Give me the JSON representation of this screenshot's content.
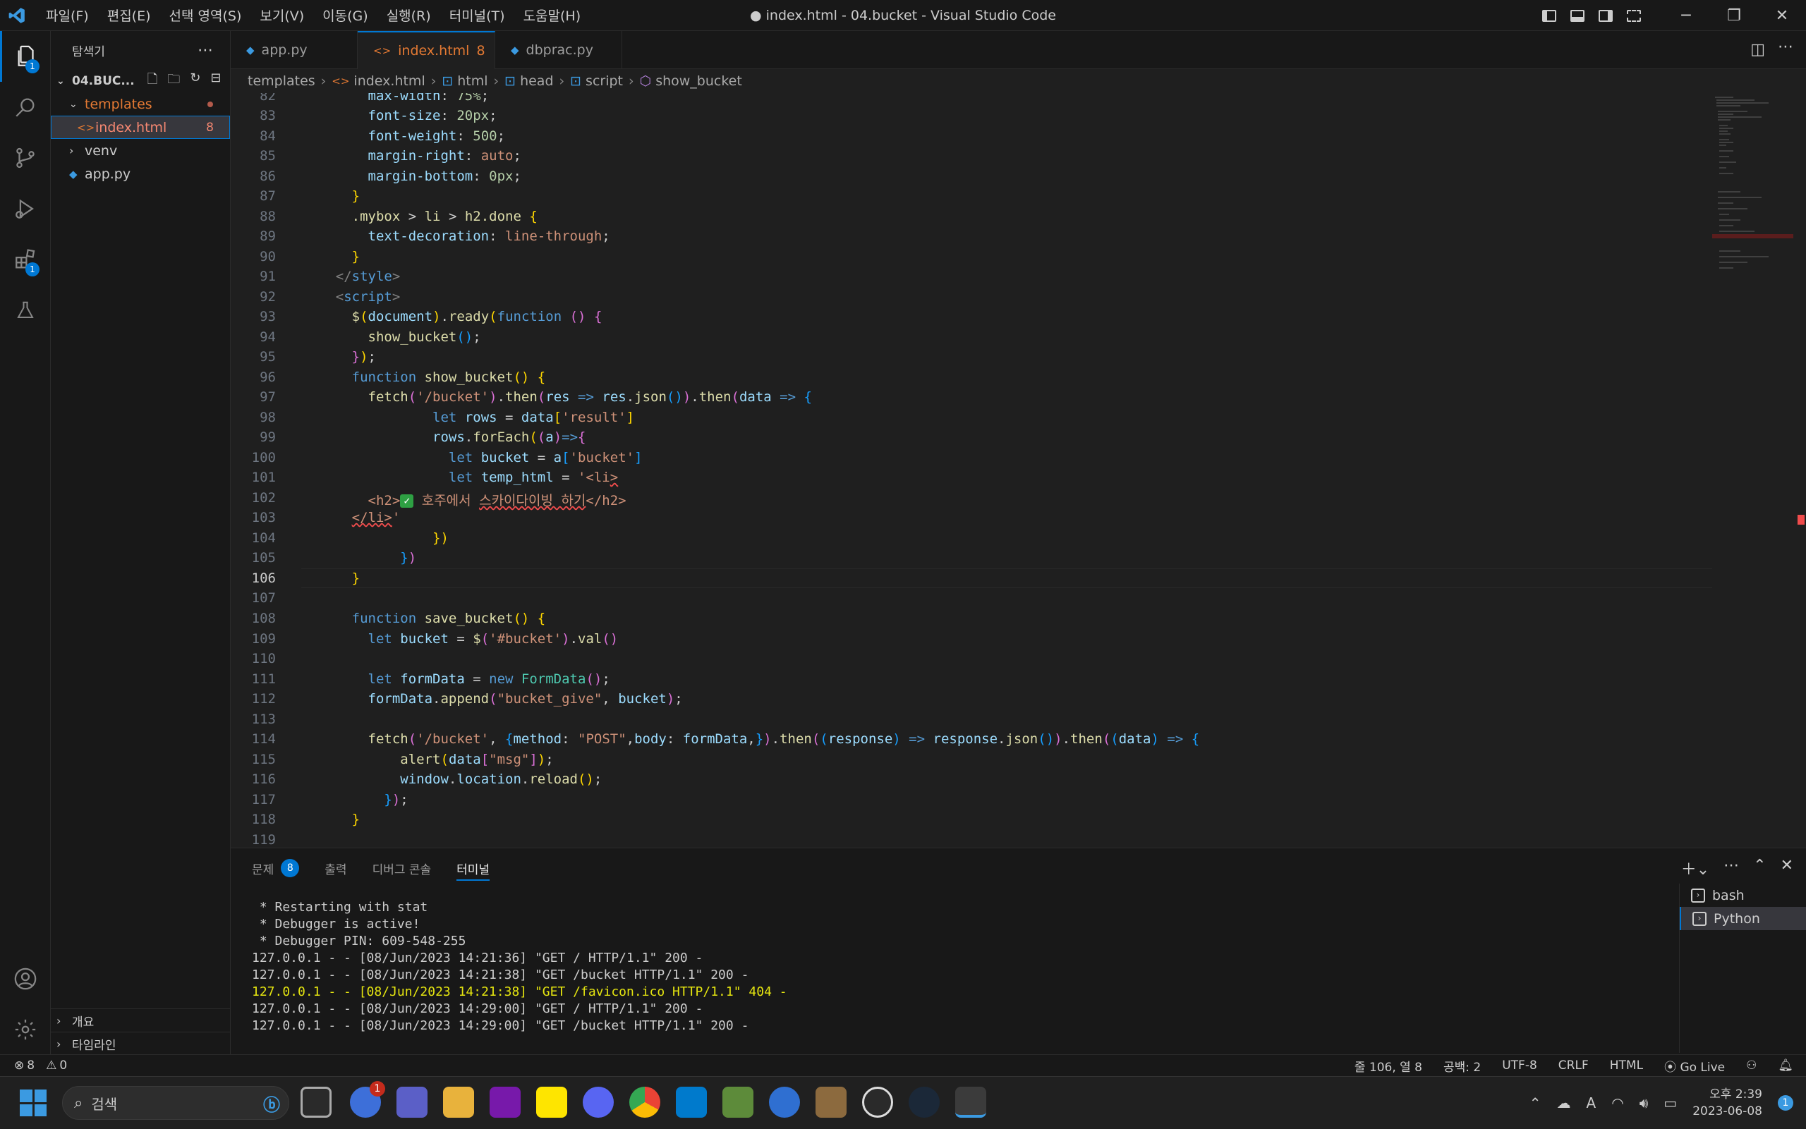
{
  "titlebar": {
    "menus": [
      "파일(F)",
      "편집(E)",
      "선택 영역(S)",
      "보기(V)",
      "이동(G)",
      "실행(R)",
      "터미널(T)",
      "도움말(H)"
    ],
    "title": "● index.html - 04.bucket - Visual Studio Code"
  },
  "sidebar": {
    "title": "탐색기",
    "folder": "04.BUC...",
    "items": [
      {
        "label": "templates",
        "type": "folder"
      },
      {
        "label": "index.html",
        "badge": "8",
        "type": "file"
      },
      {
        "label": "venv",
        "type": "folder"
      },
      {
        "label": "app.py",
        "type": "file"
      }
    ],
    "footer": [
      "개요",
      "타임라인"
    ]
  },
  "activity": {
    "explorer_badge": "1",
    "extensions_badge": "1"
  },
  "tabs": [
    {
      "label": "app.py"
    },
    {
      "label": "index.html",
      "badge": "8",
      "modified": true
    },
    {
      "label": "dbprac.py"
    }
  ],
  "breadcrumb": [
    "templates",
    "index.html",
    "html",
    "head",
    "script",
    "show_bucket"
  ],
  "editor": {
    "current_line": 106,
    "line_numbers": [
      "82",
      "83",
      "84",
      "85",
      "86",
      "87",
      "88",
      "89",
      "90",
      "91",
      "92",
      "93",
      "94",
      "95",
      "96",
      "97",
      "98",
      "99",
      "100",
      "101",
      "102",
      "103",
      "104",
      "105",
      "106",
      "107",
      "108",
      "109",
      "110",
      "111",
      "112",
      "113",
      "114",
      "115",
      "116",
      "117",
      "118",
      "119"
    ]
  },
  "panel": {
    "tabs": [
      "문제",
      "출력",
      "디버그 콘솔",
      "터미널"
    ],
    "problems_count": "8",
    "terminal_lines": [
      " * Restarting with stat",
      " * Debugger is active!",
      " * Debugger PIN: 609-548-255",
      "127.0.0.1 - - [08/Jun/2023 14:21:36] \"GET / HTTP/1.1\" 200 -",
      "127.0.0.1 - - [08/Jun/2023 14:21:38] \"GET /bucket HTTP/1.1\" 200 -",
      "127.0.0.1 - - [08/Jun/2023 14:21:38] \"GET /favicon.ico HTTP/1.1\" 404 -",
      "127.0.0.1 - - [08/Jun/2023 14:29:00] \"GET / HTTP/1.1\" 200 -",
      "127.0.0.1 - - [08/Jun/2023 14:29:00] \"GET /bucket HTTP/1.1\" 200 -"
    ],
    "terminals": [
      "bash",
      "Python"
    ]
  },
  "statusbar": {
    "errors": "8",
    "warnings": "0",
    "position": "줄 106, 열 8",
    "spaces": "공백: 2",
    "encoding": "UTF-8",
    "eol": "CRLF",
    "language": "HTML",
    "golive": "Go Live"
  },
  "taskbar": {
    "search_placeholder": "검색",
    "time": "오후 2:39",
    "date": "2023-06-08",
    "notif_badge": "1",
    "weather_badge": "1"
  }
}
